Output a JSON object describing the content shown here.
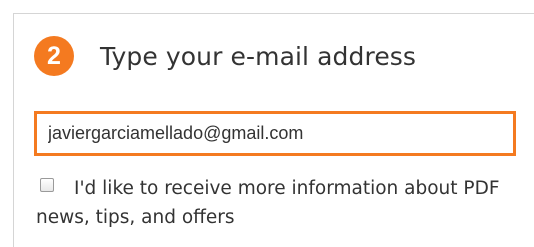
{
  "step": {
    "number": "2",
    "title": "Type your e-mail address"
  },
  "email": {
    "value": "javiergarciamellado@gmail.com"
  },
  "newsletter": {
    "checked": false,
    "label": "I'd like to receive more information about PDF news, tips, and offers"
  },
  "colors": {
    "accent": "#f47a20",
    "text": "#333333",
    "border": "#d5d5d5"
  }
}
